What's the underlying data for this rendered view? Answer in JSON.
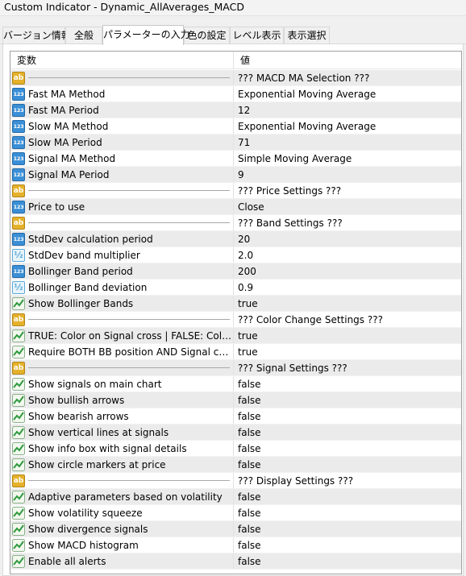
{
  "window": {
    "title": "Custom Indicator - Dynamic_AllAverages_MACD"
  },
  "tabs": [
    {
      "label": "バージョン情報",
      "active": false
    },
    {
      "label": "全般",
      "active": false
    },
    {
      "label": "パラメーターの入力",
      "active": true
    },
    {
      "label": "色の設定",
      "active": false
    },
    {
      "label": "レベル表示",
      "active": false
    },
    {
      "label": "表示選択",
      "active": false
    }
  ],
  "grid": {
    "header": {
      "variable": "変数",
      "value": "値"
    },
    "icon_types": {
      "str": {
        "glyph": "ab",
        "color": "#e5b12a"
      },
      "int": {
        "glyph": "123",
        "color": "#3a8fd6"
      },
      "dbl": {
        "glyph": "½",
        "color": "#5aaad9"
      },
      "bool": {
        "glyph": "chart-line-icon",
        "color": "#2e9a3e"
      }
    },
    "rows": [
      {
        "type": "str",
        "name": "",
        "value": "??? MACD MA Selection ???",
        "separator": true
      },
      {
        "type": "int",
        "name": "Fast MA Method",
        "value": "Exponential Moving Average"
      },
      {
        "type": "int",
        "name": "Fast MA Period",
        "value": "12"
      },
      {
        "type": "int",
        "name": "Slow MA Method",
        "value": "Exponential Moving Average"
      },
      {
        "type": "int",
        "name": "Slow MA Period",
        "value": "71"
      },
      {
        "type": "int",
        "name": "Signal MA Method",
        "value": "Simple Moving Average"
      },
      {
        "type": "int",
        "name": "Signal MA Period",
        "value": "9"
      },
      {
        "type": "str",
        "name": "",
        "value": "??? Price Settings ???",
        "separator": true
      },
      {
        "type": "int",
        "name": "Price to use",
        "value": "Close"
      },
      {
        "type": "str",
        "name": "",
        "value": "??? Band Settings ???",
        "separator": true
      },
      {
        "type": "int",
        "name": "StdDev calculation period",
        "value": "20"
      },
      {
        "type": "dbl",
        "name": "StdDev band multiplier",
        "value": "2.0"
      },
      {
        "type": "int",
        "name": "Bollinger Band period",
        "value": "200"
      },
      {
        "type": "dbl",
        "name": "Bollinger Band deviation",
        "value": "0.9"
      },
      {
        "type": "bool",
        "name": "Show Bollinger Bands",
        "value": "true"
      },
      {
        "type": "str",
        "name": "",
        "value": "??? Color Change Settings ???",
        "separator": true
      },
      {
        "type": "bool",
        "name": "TRUE: Color on Signal cross | FALSE: Color on ...",
        "value": "true"
      },
      {
        "type": "bool",
        "name": "Require BOTH BB position AND Signal cross",
        "value": "true"
      },
      {
        "type": "str",
        "name": "",
        "value": "??? Signal Settings ???",
        "separator": true
      },
      {
        "type": "bool",
        "name": "Show signals on main chart",
        "value": "false"
      },
      {
        "type": "bool",
        "name": "Show bullish arrows",
        "value": "false"
      },
      {
        "type": "bool",
        "name": "Show bearish arrows",
        "value": "false"
      },
      {
        "type": "bool",
        "name": "Show vertical lines at signals",
        "value": "false"
      },
      {
        "type": "bool",
        "name": "Show info box with signal details",
        "value": "false"
      },
      {
        "type": "bool",
        "name": "Show circle markers at price",
        "value": "false"
      },
      {
        "type": "str",
        "name": "",
        "value": "??? Display Settings ???",
        "separator": true
      },
      {
        "type": "bool",
        "name": "Adaptive parameters based on volatility",
        "value": "false"
      },
      {
        "type": "bool",
        "name": "Show volatility squeeze",
        "value": "false"
      },
      {
        "type": "bool",
        "name": "Show divergence signals",
        "value": "false"
      },
      {
        "type": "bool",
        "name": "Show MACD histogram",
        "value": "false"
      },
      {
        "type": "bool",
        "name": "Enable all alerts",
        "value": "false"
      }
    ]
  }
}
